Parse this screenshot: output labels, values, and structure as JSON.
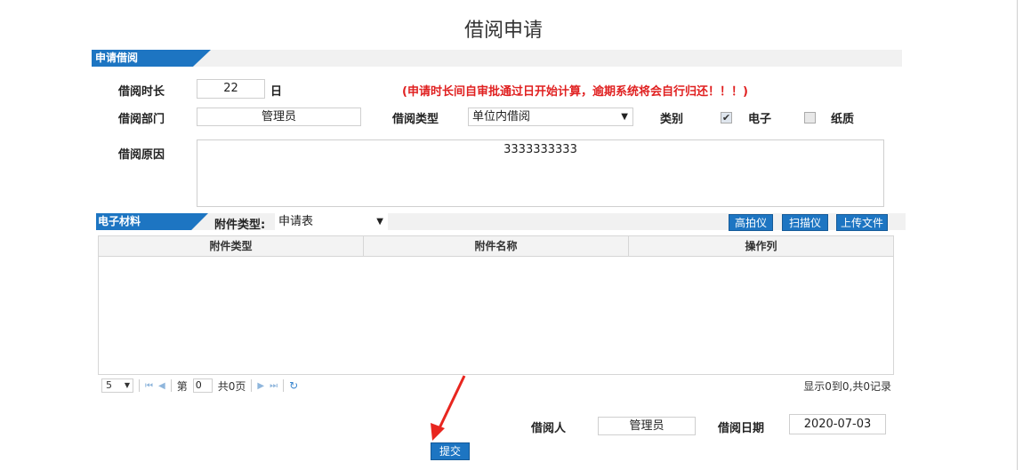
{
  "page": {
    "title": "借阅申请"
  },
  "apply_section": {
    "tab_label": "申请借阅",
    "duration_label": "借阅时长",
    "duration_value": "22",
    "duration_unit": "日",
    "notice": "(申请时长间自审批通过日开始计算，逾期系统将会自行归还！！！)",
    "dept_label": "借阅部门",
    "dept_value": "管理员",
    "type_label": "借阅类型",
    "type_value": "单位内借阅",
    "category_label": "类别",
    "category_options": [
      {
        "label": "电子",
        "checked": true
      },
      {
        "label": "纸质",
        "checked": false
      }
    ],
    "reason_label": "借阅原因",
    "reason_value": "3333333333"
  },
  "materials_section": {
    "tab_label": "电子材料",
    "attach_type_label": "附件类型:",
    "attach_type_value": "申请表",
    "buttons": {
      "scanner_hd": "高拍仪",
      "scanner": "扫描仪",
      "upload": "上传文件"
    },
    "columns": [
      "附件类型",
      "附件名称",
      "操作列"
    ],
    "rows": [],
    "pager": {
      "page_size": "5",
      "page_prefix": "第",
      "page_value": "0",
      "page_total": "共0页",
      "summary": "显示0到0,共0记录"
    }
  },
  "footer": {
    "borrower_label": "借阅人",
    "borrower_value": "管理员",
    "date_label": "借阅日期",
    "date_value": "2020-07-03",
    "submit_label": "提交"
  }
}
